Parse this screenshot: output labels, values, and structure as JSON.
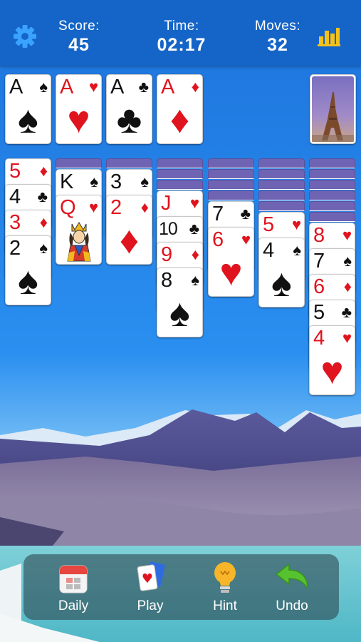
{
  "header": {
    "score_label": "Score:",
    "score_value": "45",
    "time_label": "Time:",
    "time_value": "02:17",
    "moves_label": "Moves:",
    "moves_value": "32",
    "settings_icon": "gear-icon",
    "stats_icon": "bar-chart-icon"
  },
  "foundations": [
    {
      "rank": "A",
      "suit": "♠",
      "color": "black"
    },
    {
      "rank": "A",
      "suit": "♥",
      "color": "red"
    },
    {
      "rank": "A",
      "suit": "♣",
      "color": "black"
    },
    {
      "rank": "A",
      "suit": "♦",
      "color": "red"
    }
  ],
  "stock": {
    "image": "eiffel-tower-card-back"
  },
  "tableau": [
    {
      "hidden": 0,
      "cards": [
        {
          "rank": "5",
          "suit": "♦",
          "color": "red"
        },
        {
          "rank": "4",
          "suit": "♣",
          "color": "black"
        },
        {
          "rank": "3",
          "suit": "♦",
          "color": "red"
        },
        {
          "rank": "2",
          "suit": "♠",
          "color": "black"
        }
      ]
    },
    {
      "hidden": 1,
      "cards": [
        {
          "rank": "K",
          "suit": "♠",
          "color": "black"
        },
        {
          "rank": "Q",
          "suit": "♥",
          "color": "red"
        }
      ]
    },
    {
      "hidden": 1,
      "cards": [
        {
          "rank": "3",
          "suit": "♠",
          "color": "black"
        },
        {
          "rank": "2",
          "suit": "♦",
          "color": "red"
        }
      ]
    },
    {
      "hidden": 3,
      "cards": [
        {
          "rank": "J",
          "suit": "♥",
          "color": "red"
        },
        {
          "rank": "10",
          "suit": "♣",
          "color": "black"
        },
        {
          "rank": "9",
          "suit": "♦",
          "color": "red"
        },
        {
          "rank": "8",
          "suit": "♠",
          "color": "black"
        }
      ]
    },
    {
      "hidden": 4,
      "cards": [
        {
          "rank": "7",
          "suit": "♣",
          "color": "black"
        },
        {
          "rank": "6",
          "suit": "♥",
          "color": "red"
        }
      ]
    },
    {
      "hidden": 5,
      "cards": [
        {
          "rank": "5",
          "suit": "♥",
          "color": "red"
        },
        {
          "rank": "4",
          "suit": "♠",
          "color": "black"
        }
      ]
    },
    {
      "hidden": 6,
      "cards": [
        {
          "rank": "8",
          "suit": "♥",
          "color": "red"
        },
        {
          "rank": "7",
          "suit": "♠",
          "color": "black"
        },
        {
          "rank": "6",
          "suit": "♦",
          "color": "red"
        },
        {
          "rank": "5",
          "suit": "♣",
          "color": "black"
        },
        {
          "rank": "4",
          "suit": "♥",
          "color": "red"
        }
      ]
    }
  ],
  "toolbar": {
    "daily_label": "Daily",
    "play_label": "Play",
    "hint_label": "Hint",
    "undo_label": "Undo"
  }
}
